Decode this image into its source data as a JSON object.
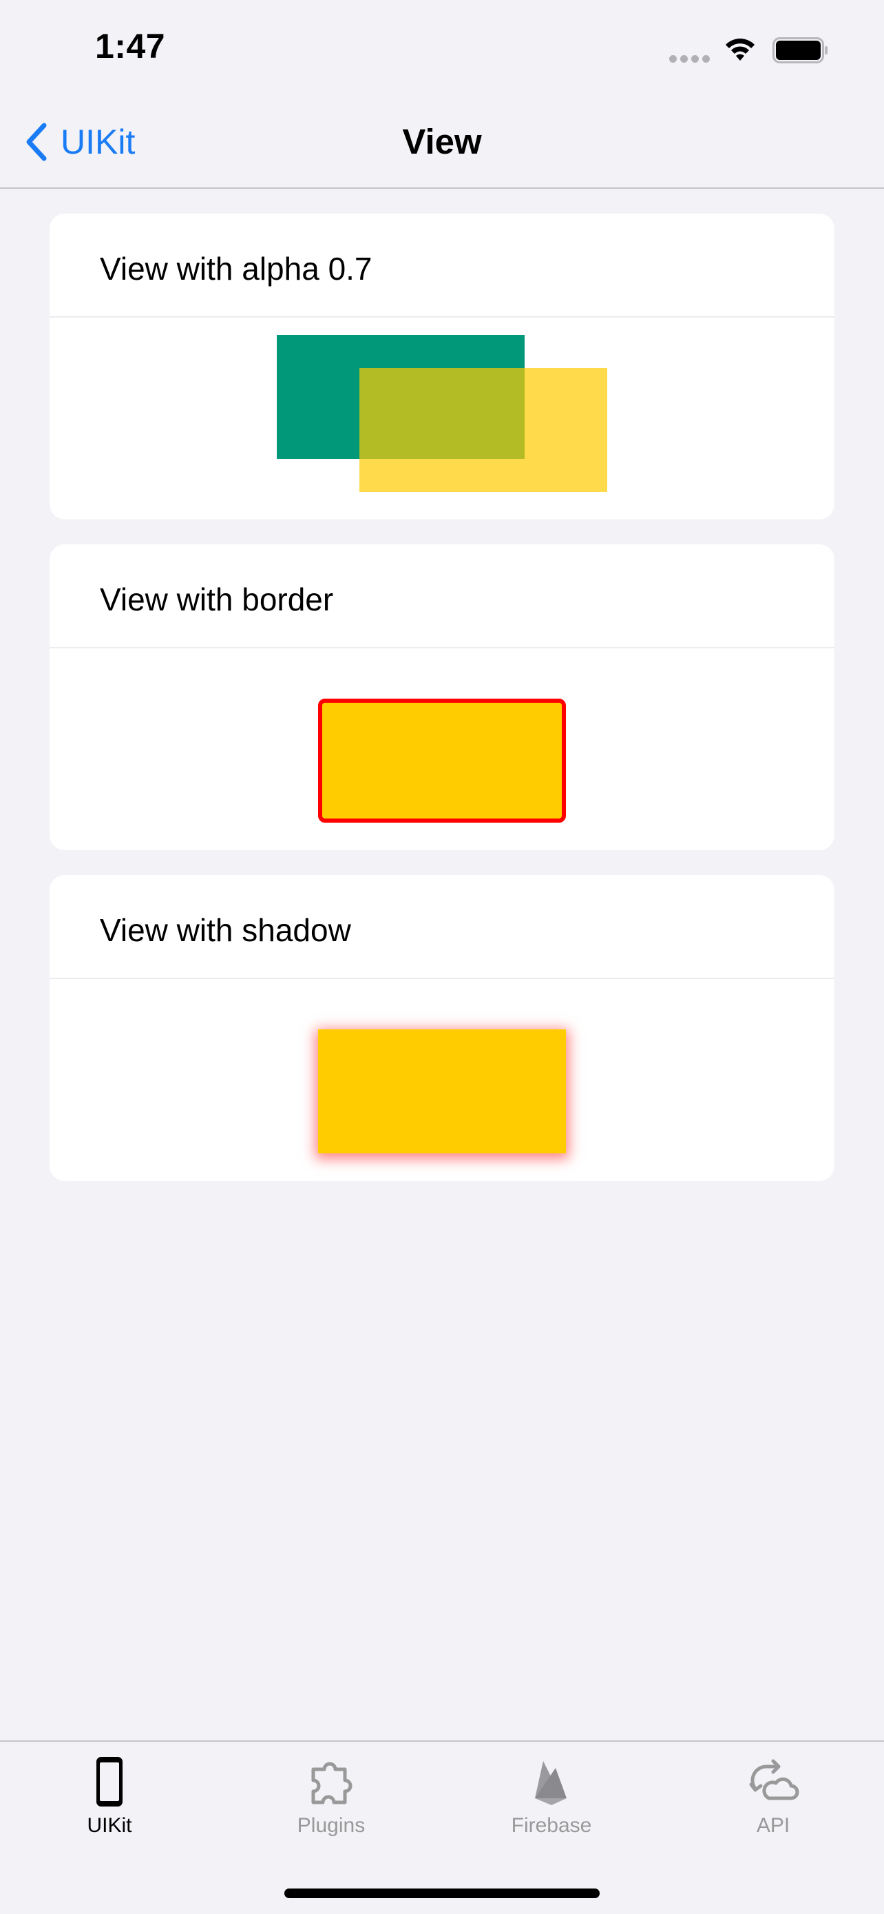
{
  "status_bar": {
    "time": "1:47"
  },
  "nav": {
    "back_label": "UIKit",
    "title": "View"
  },
  "cards": [
    {
      "title": "View with alpha 0.7",
      "alpha": 0.7
    },
    {
      "title": "View with border"
    },
    {
      "title": "View with shadow"
    }
  ],
  "tab_bar": {
    "items": [
      {
        "label": "UIKit",
        "icon": "phone-icon",
        "active": true
      },
      {
        "label": "Plugins",
        "icon": "puzzle-icon",
        "active": false
      },
      {
        "label": "Firebase",
        "icon": "firebase-icon",
        "active": false
      },
      {
        "label": "API",
        "icon": "cloud-sync-icon",
        "active": false
      }
    ]
  },
  "colors": {
    "accent": "#1a7cf5",
    "background": "#f2f2f7",
    "green": "#009879",
    "yellow": "#ffcc00",
    "border_red": "#ff0000",
    "inactive_tab": "#999999"
  }
}
